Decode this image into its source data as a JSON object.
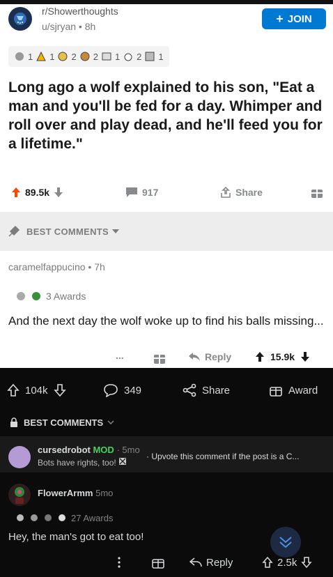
{
  "post": {
    "subreddit": "r/Showerthoughts",
    "user": "u/sjryan",
    "age": "8h",
    "join_label": "JOIN",
    "awards": [
      {
        "icon": "award-icon-1",
        "count": "1"
      },
      {
        "icon": "award-icon-2",
        "count": "1"
      },
      {
        "icon": "award-icon-3",
        "count": "2"
      },
      {
        "icon": "award-icon-4",
        "count": "2"
      },
      {
        "icon": "award-icon-5",
        "count": "1"
      },
      {
        "icon": "award-icon-6",
        "count": "2"
      },
      {
        "icon": "award-icon-7",
        "count": "1"
      }
    ],
    "title": "Long ago a wolf explained to his son, \"Eat a man and you'll be fed for a day. Whimper and roll over and play dead, and he'll feed you for a lifetime.\"",
    "votes": "89.5k",
    "comments": "917",
    "share_label": "Share"
  },
  "best_comments_label": "BEST COMMENTS",
  "comment1": {
    "user": "caramelfappucino",
    "age": "7h",
    "awards_label": "3 Awards",
    "body": "And the next day the wolf woke up to find his balls missing...",
    "reply_label": "Reply",
    "votes": "15.9k",
    "more": "..."
  },
  "dark_bar": {
    "votes": "104k",
    "comments": "349",
    "share_label": "Share",
    "award_label": "Award"
  },
  "dark_best_label": "BEST COMMENTS",
  "comment2": {
    "user": "cursedrobot",
    "mod_label": "MOD",
    "age": "5mo",
    "body": "Bots have rights, too!",
    "side_text": "Upvote this comment if the post is a C..."
  },
  "comment3": {
    "user": "FlowerArmm",
    "age": "5mo",
    "awards_label": "27 Awards",
    "body": "Hey, the man's got to eat too!",
    "reply_label": "Reply",
    "votes": "2.5k"
  },
  "colors": {
    "join_bg": "#0079d3",
    "upvote": "#ff4500",
    "mod": "#46d160"
  }
}
